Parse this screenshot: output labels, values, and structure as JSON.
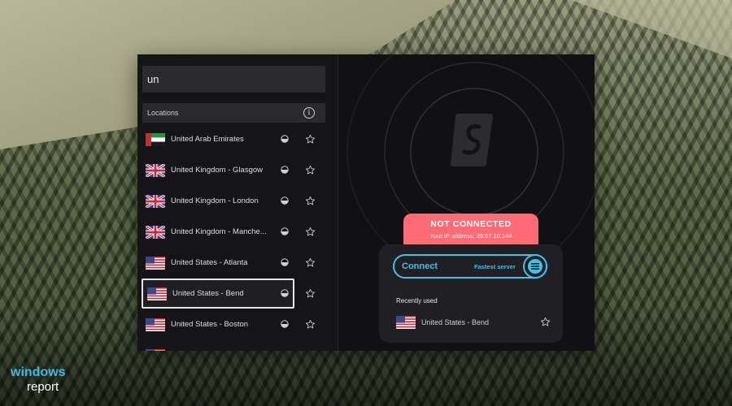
{
  "watermark": {
    "line1": "windows",
    "line2": "report"
  },
  "search": {
    "value": "un"
  },
  "locations": {
    "header": "Locations",
    "info_icon": "info-icon",
    "items": [
      {
        "name": "United Arab Emirates",
        "flag": "ae",
        "load": "low"
      },
      {
        "name": "United Kingdom - Glasgow",
        "flag": "gb",
        "load": "low"
      },
      {
        "name": "United Kingdom - London",
        "flag": "gb",
        "load": "low"
      },
      {
        "name": "United Kingdom - Manche...",
        "flag": "gb",
        "load": "low"
      },
      {
        "name": "United States - Atlanta",
        "flag": "us",
        "load": "low"
      },
      {
        "name": "United States - Bend",
        "flag": "us",
        "load": "low",
        "selected": true
      },
      {
        "name": "United States - Boston",
        "flag": "us",
        "load": "low"
      },
      {
        "name": "",
        "flag": "us",
        "load": "low"
      }
    ]
  },
  "status": {
    "title": "NOT CONNECTED",
    "ip": "Your IP address: 39.57.10.144",
    "color": "#ff6b74"
  },
  "connect": {
    "label": "Connect",
    "server": "Fastest server",
    "accent": "#3fc2e8"
  },
  "recent": {
    "title": "Recently used",
    "items": [
      {
        "name": "United States - Bend",
        "flag": "us"
      }
    ]
  },
  "brand": {
    "logo": "surfshark-logo"
  }
}
